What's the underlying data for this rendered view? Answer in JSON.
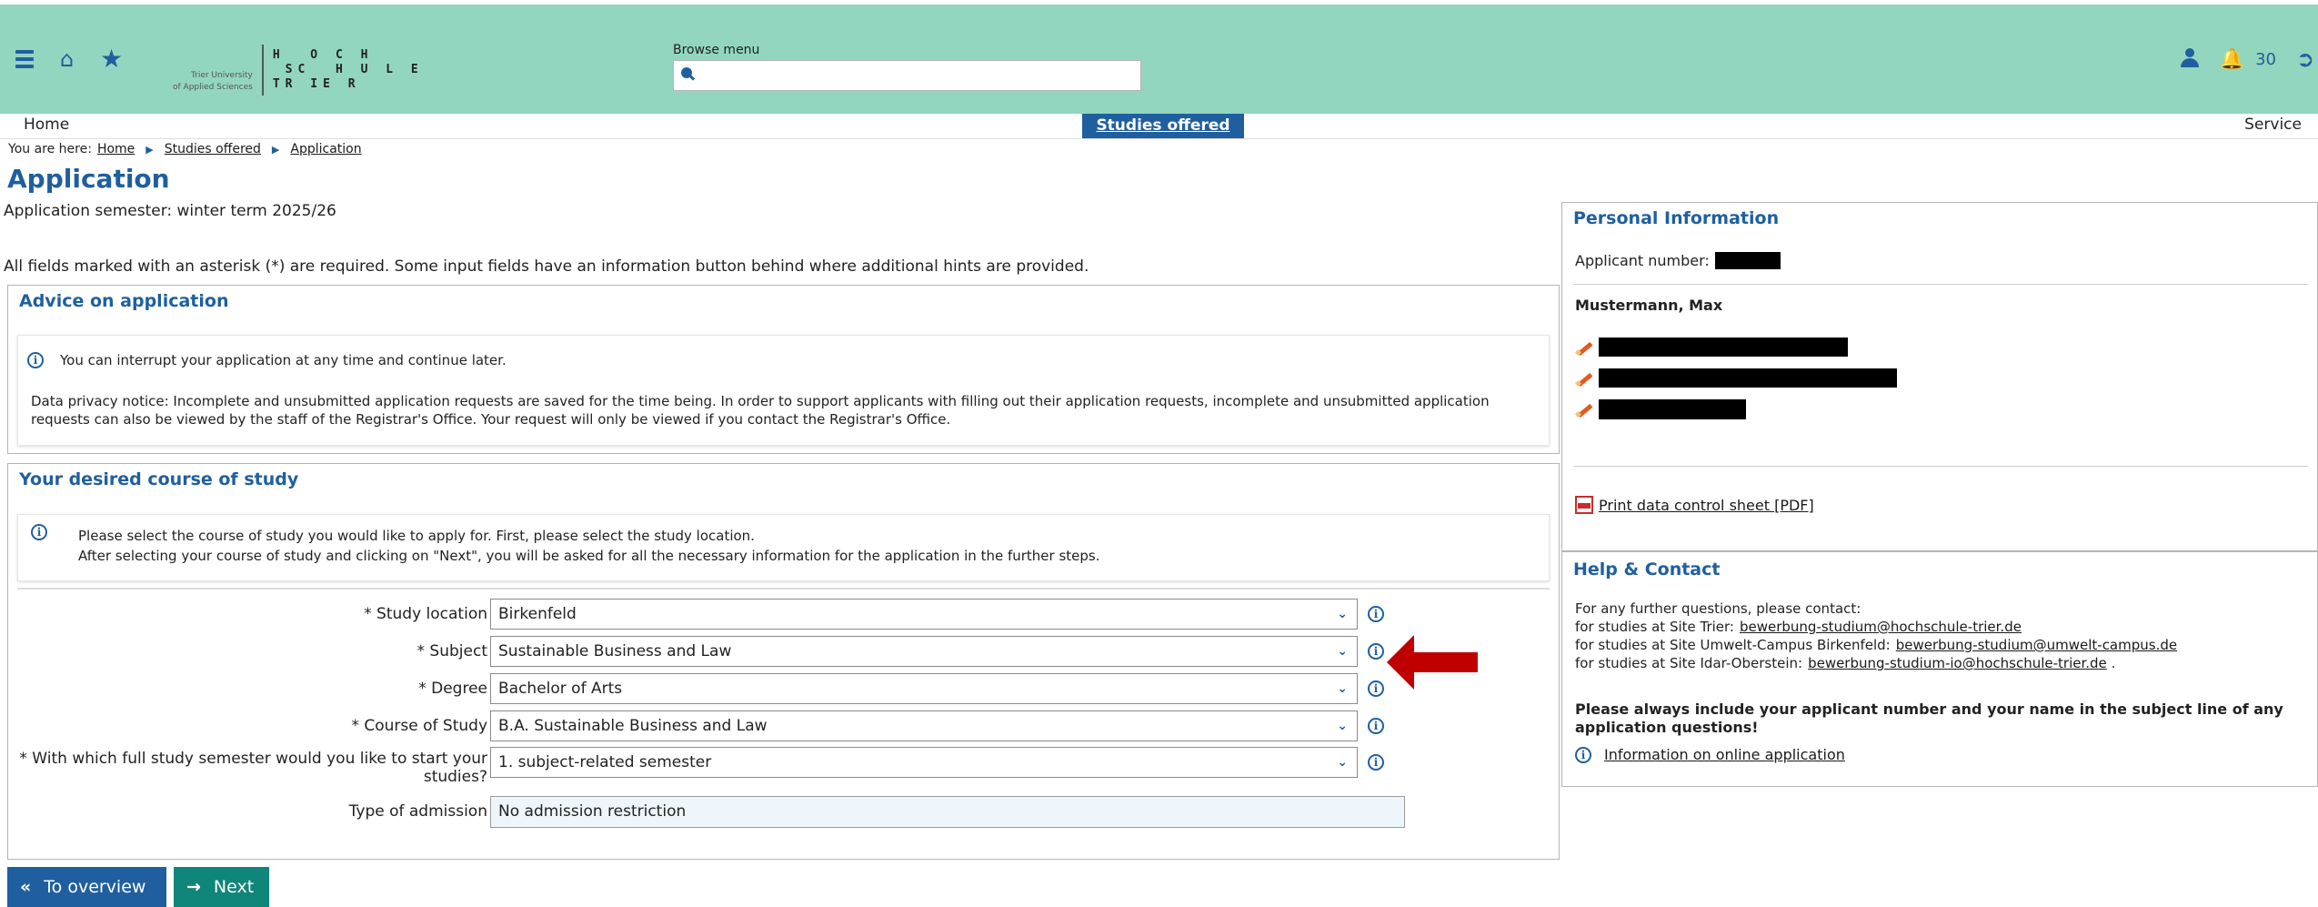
{
  "header": {
    "logo_sub_line1": "Trier University",
    "logo_sub_line2": "of Applied Sciences",
    "logo_line1": "H  O C H",
    "logo_line2": " SC  H U L E",
    "logo_line3": "TR IE R",
    "browse_label": "Browse menu",
    "notification_count": "30"
  },
  "nav": {
    "home": "Home",
    "studies_offered": "Studies offered",
    "service": "Service"
  },
  "breadcrumb": {
    "prefix": "You are here:",
    "items": [
      "Home",
      "Studies offered",
      "Application"
    ]
  },
  "page": {
    "title": "Application",
    "semester": "Application semester: winter term 2025/26",
    "required_note": "All fields marked with an asterisk (*) are required. Some input fields have an information button behind where additional hints are provided."
  },
  "advice": {
    "title": "Advice on application",
    "hint1": "You can interrupt your application at any time and continue later.",
    "hint2": "Data privacy notice: Incomplete and unsubmitted application requests are saved for the time being. In order to support applicants with filling out their application requests, incomplete and unsubmitted application requests can also be viewed by the staff of the Registrar's Office. Your request will only be viewed if you contact the Registrar's Office."
  },
  "course": {
    "title": "Your desired course of study",
    "hint_line1": "Please select the course of study you would like to apply for. First, please select the study location.",
    "hint_line2": "After selecting your course of study and clicking on \"Next\", you will be asked for all the necessary information for the application in the further steps.",
    "fields": [
      {
        "label": "* Study location",
        "value": "Birkenfeld"
      },
      {
        "label": "* Subject",
        "value": "Sustainable Business and Law"
      },
      {
        "label": "* Degree",
        "value": "Bachelor of Arts"
      },
      {
        "label": "* Course of Study",
        "value": "B.A. Sustainable Business and Law"
      },
      {
        "label_line1": "* With which full study semester would you like to start your",
        "label_line2": "studies?",
        "value": "1. subject-related semester"
      }
    ],
    "admission_label": "Type of admission",
    "admission_value": "No admission restriction"
  },
  "buttons": {
    "overview": "To overview",
    "next": "Next"
  },
  "personal": {
    "title": "Personal Information",
    "applicant_label": "Applicant number:",
    "name": "Mustermann, Max",
    "print_link": "Print data control sheet [PDF]"
  },
  "help": {
    "title": "Help & Contact",
    "intro": "For any further questions, please contact:",
    "trier_label": "for studies at Site Trier:",
    "trier_email": "bewerbung-studium@hochschule-trier.de",
    "birkenfeld_label": "for studies at Site Umwelt-Campus Birkenfeld:",
    "birkenfeld_email": "bewerbung-studium@umwelt-campus.de",
    "idar_label": "for studies at Site Idar-Oberstein:",
    "idar_email": "bewerbung-studium-io@hochschule-trier.de",
    "note": "Please always include your applicant number and your name in the subject line of any application questions!",
    "info_link": "Information on online application"
  },
  "colors": {
    "header_bg": "#93d6bf",
    "primary": "#1f5f9f",
    "next_button": "#10857a",
    "arrow": "#c00000"
  }
}
